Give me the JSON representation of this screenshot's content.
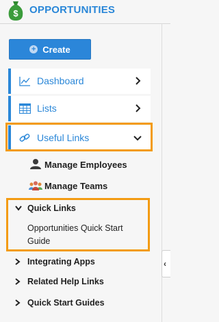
{
  "header": {
    "title": "OPPORTUNITIES",
    "logo_icon": "money-bag-icon"
  },
  "create_button": {
    "label": "Create"
  },
  "nav": [
    {
      "label": "Dashboard",
      "icon": "line-chart-icon",
      "chevron": "chevron-right"
    },
    {
      "label": "Lists",
      "icon": "grid-list-icon",
      "chevron": "chevron-right"
    },
    {
      "label": "Useful Links",
      "icon": "link-icon",
      "chevron": "chevron-down"
    }
  ],
  "useful_links": [
    {
      "label": "Manage Employees",
      "icon": "person-icon"
    },
    {
      "label": "Manage Teams",
      "icon": "team-icon"
    }
  ],
  "quick_links": {
    "title": "Quick Links",
    "item": "Opportunities Quick Start Guide"
  },
  "sections": [
    "Integrating Apps",
    "Related Help Links",
    "Quick Start Guides"
  ],
  "colors": {
    "accent": "#2a87d8",
    "highlight": "#f39b12",
    "button": "#2b86d9"
  }
}
